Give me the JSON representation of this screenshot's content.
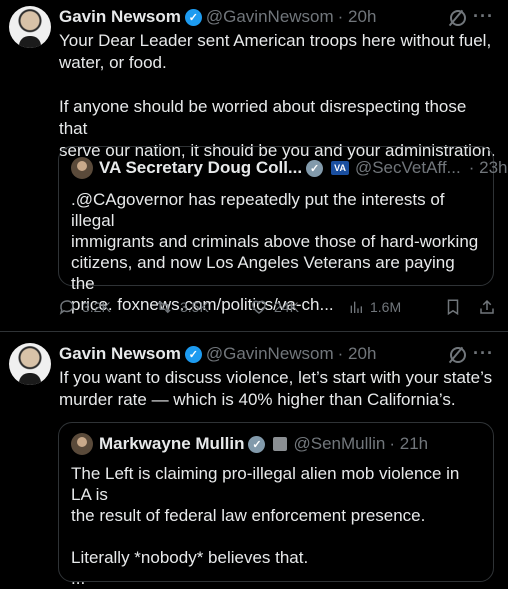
{
  "tweets": [
    {
      "author": "Gavin Newsom",
      "handle": "@GavinNewsom",
      "time": "· 20h",
      "verified_mark": "✓",
      "more": "···",
      "lines": [
        "Your Dear Leader sent American troops here without fuel,",
        "water, or food.",
        "",
        "If anyone should be worried about disrespecting those that",
        "serve our nation, it should be you and your administration."
      ],
      "quote": {
        "author": "VA Secretary Doug Coll...",
        "badge": "VA",
        "handle": "@SecVetAff...",
        "time": "· 23h",
        "lines": [
          ".@CAgovernor has repeatedly put the interests of illegal",
          "immigrants and criminals above those of hard-working",
          "citizens, and now Los Angeles Veterans are paying the",
          "price. foxnews.com/politics/va-ch..."
        ]
      },
      "stats": {
        "replies": "3.2K",
        "reposts": "3.5K",
        "likes": "24K",
        "views": "1.6M"
      }
    },
    {
      "author": "Gavin Newsom",
      "handle": "@GavinNewsom",
      "time": "· 20h",
      "verified_mark": "✓",
      "more": "···",
      "lines": [
        "If you want to discuss violence, let’s start with your state’s",
        "murder rate — which is 40% higher than California’s."
      ],
      "quote": {
        "author": "Markwayne Mullin",
        "handle": "@SenMullin",
        "time": "· 21h",
        "lines": [
          "The Left is claiming pro-illegal alien mob violence in LA is",
          "the result of federal law enforcement presence.",
          "",
          "Literally *nobody* believes that.",
          "..."
        ]
      }
    }
  ],
  "colors": {
    "background": "#000000",
    "text": "#e7e9ea",
    "muted": "#71767b",
    "verified": "#1d9bf0",
    "border": "#2f3336"
  },
  "icons": [
    "grok-icon",
    "more-icon",
    "reply-icon",
    "repost-icon",
    "like-icon",
    "views-icon",
    "bookmark-icon",
    "share-icon"
  ]
}
